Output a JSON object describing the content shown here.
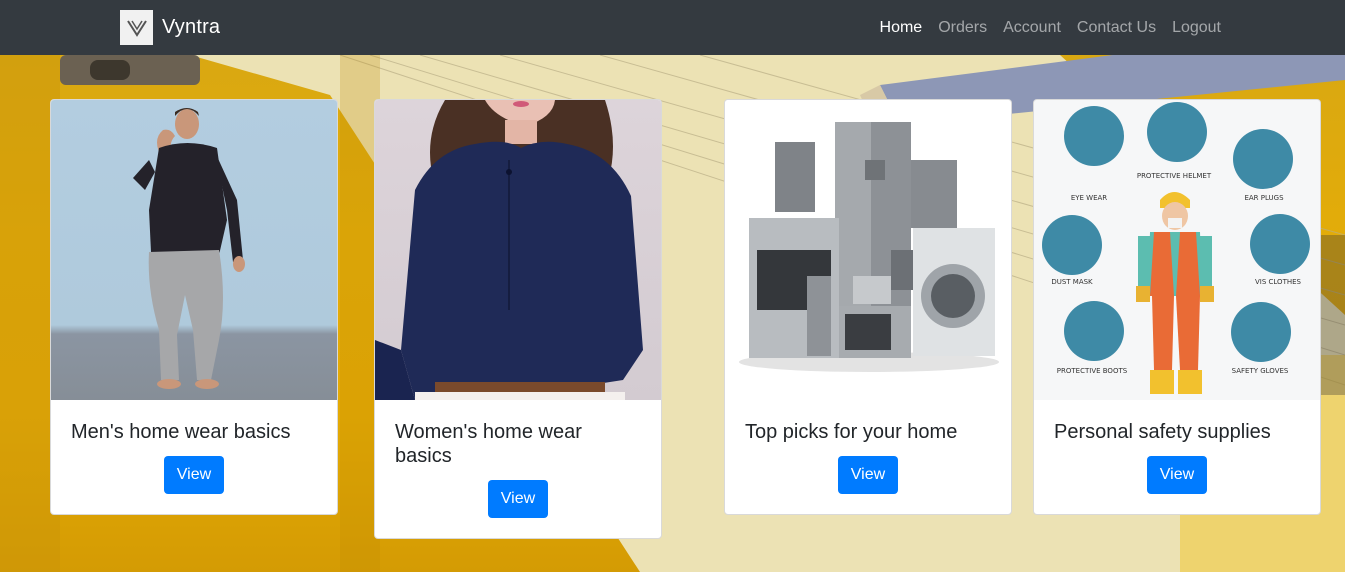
{
  "navbar": {
    "brand": "Vyntra",
    "links": [
      "Home",
      "Orders",
      "Account",
      "Contact Us",
      "Logout"
    ],
    "active": "Home"
  },
  "cards": [
    {
      "title": "Men's home wear basics",
      "button": "View"
    },
    {
      "title": "Women's home wear basics",
      "button": "View"
    },
    {
      "title": "Top picks for your home",
      "button": "View"
    },
    {
      "title": "Personal safety supplies",
      "button": "View"
    }
  ],
  "safety_labels": {
    "eye_wear": "EYE WEAR",
    "helmet": "PROTECTIVE HELMET",
    "ear_plugs": "EAR PLUGS",
    "dust_mask": "DUST MASK",
    "vis_clothes": "VIS CLOTHES",
    "boots": "PROTECTIVE BOOTS",
    "gloves": "SAFETY GLOVES"
  },
  "colors": {
    "navbar": "#343a40",
    "button": "#007bff",
    "background": "#e4aa05"
  }
}
